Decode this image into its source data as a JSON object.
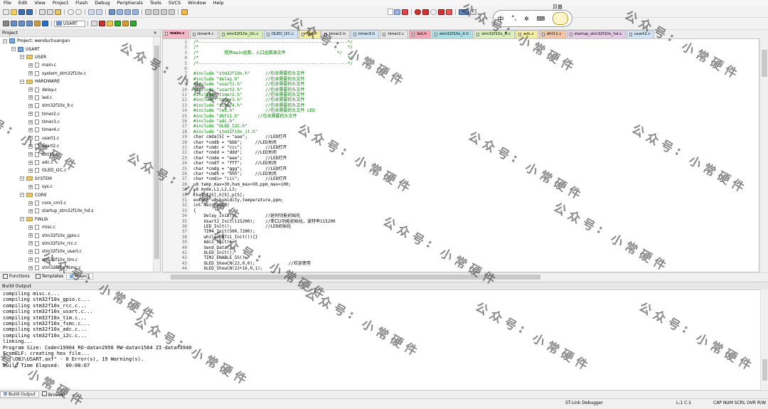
{
  "menu": [
    "File",
    "Edit",
    "View",
    "Project",
    "Flash",
    "Debug",
    "Peripherals",
    "Tools",
    "SVCS",
    "Window",
    "Help"
  ],
  "toolbar": {
    "target": "USART"
  },
  "ime": {
    "lang": "中",
    "extra": "°,",
    "user": "贝普"
  },
  "project_panel": {
    "title": "Project",
    "close": "× ",
    "tree": [
      {
        "level": 0,
        "type": "root",
        "label": "Project: wenduchuangan"
      },
      {
        "level": 1,
        "type": "target",
        "label": "USART"
      },
      {
        "level": 2,
        "type": "folder",
        "label": "USER"
      },
      {
        "level": 3,
        "type": "file",
        "label": "main.c"
      },
      {
        "level": 3,
        "type": "file",
        "label": "system_stm32f10x.c"
      },
      {
        "level": 2,
        "type": "folder",
        "label": "HARDWARE"
      },
      {
        "level": 3,
        "type": "file",
        "label": "delay.c"
      },
      {
        "level": 3,
        "type": "file",
        "label": "led.c"
      },
      {
        "level": 3,
        "type": "file",
        "label": "stm32f10x_it.c"
      },
      {
        "level": 3,
        "type": "file",
        "label": "timer2.c"
      },
      {
        "level": 3,
        "type": "file",
        "label": "timer3.c"
      },
      {
        "level": 3,
        "type": "file",
        "label": "timer4.c"
      },
      {
        "level": 3,
        "type": "file",
        "label": "usart1.c"
      },
      {
        "level": 3,
        "type": "file",
        "label": "usart2.c"
      },
      {
        "level": 3,
        "type": "file",
        "label": "dht11.c"
      },
      {
        "level": 3,
        "type": "file",
        "label": "adc.c"
      },
      {
        "level": 3,
        "type": "file",
        "label": "OLED_I2C.c"
      },
      {
        "level": 2,
        "type": "folder",
        "label": "SYSTEM"
      },
      {
        "level": 3,
        "type": "file",
        "label": "sys.c"
      },
      {
        "level": 2,
        "type": "folder",
        "label": "CORE"
      },
      {
        "level": 3,
        "type": "file",
        "label": "core_cm3.c"
      },
      {
        "level": 3,
        "type": "file",
        "label": "startup_stm32f10x_hd.s"
      },
      {
        "level": 2,
        "type": "folder",
        "label": "FWLib"
      },
      {
        "level": 3,
        "type": "file",
        "label": "misc.c"
      },
      {
        "level": 3,
        "type": "file",
        "label": "stm32f10x_gpio.c"
      },
      {
        "level": 3,
        "type": "file",
        "label": "stm32f10x_rcc.c"
      },
      {
        "level": 3,
        "type": "file",
        "label": "stm32f10x_usart.c"
      },
      {
        "level": 3,
        "type": "file",
        "label": "stm32f10x_tim.c"
      },
      {
        "level": 3,
        "type": "file",
        "label": "stm32f10x_fsmc.c"
      }
    ],
    "tabs": [
      "Functions",
      "Templates",
      "Project"
    ]
  },
  "file_tabs": [
    {
      "label": "main.c",
      "color": "#f3b7c7",
      "active": true
    },
    {
      "label": "timer4.c",
      "color": "#e6e6e6"
    },
    {
      "label": "stm32f10x_i2c.c",
      "color": "#d9f0b8"
    },
    {
      "label": "OLED_I2C.c",
      "color": "#cfe3f7"
    },
    {
      "label": "led.c",
      "color": "#f7ee9a"
    },
    {
      "label": "timer2.h",
      "color": "#e6e6e6"
    },
    {
      "label": "timer3.h",
      "color": "#cfe3f7"
    },
    {
      "label": "timer2.c",
      "color": "#e6e6e6"
    },
    {
      "label": "led.h",
      "color": "#f2a6b6"
    },
    {
      "label": "stm32f10x_it.h",
      "color": "#a8e0e8"
    },
    {
      "label": "stm32f10x_it.c",
      "color": "#d9f0b8"
    },
    {
      "label": "adc.c",
      "color": "#f7ee9a"
    },
    {
      "label": "dht11.c",
      "color": "#f3c4a6"
    },
    {
      "label": "startup_stm32f10x_hd.s",
      "color": "#e5cbe8"
    },
    {
      "label": "usart2.c",
      "color": "#cfe3f7"
    }
  ],
  "code": [
    {
      "n": "1",
      "t": "/*----------------------------------------------------------*/",
      "c": "#008000"
    },
    {
      "n": "2",
      "t": "/*                                                          */",
      "c": "#008000"
    },
    {
      "n": "3",
      "t": "/*          程序main函数，入口函数源文件                    */",
      "c": "#008000"
    },
    {
      "n": "4",
      "t": "/*                                                          */",
      "c": "#008000"
    },
    {
      "n": "5",
      "t": "/*----------------------------------------------------------*/",
      "c": "#008000"
    },
    {
      "n": "6",
      "t": "",
      "c": "#000"
    },
    {
      "n": "7",
      "t": "#include \"stm32f10x.h\"      //包含需要的头文件",
      "c": "#008000"
    },
    {
      "n": "8",
      "t": "#include \"delay.h\"          //包含需要的头文件",
      "c": "#008000"
    },
    {
      "n": "9",
      "t": "#include \"usart1.h\"         //包含需要的头文件",
      "c": "#008000"
    },
    {
      "n": "10",
      "t": "#include \"usart2.h\"         //包含需要的头文件",
      "c": "#008000"
    },
    {
      "n": "11",
      "t": "#include \"timer2.h\"         //包含需要的头文件",
      "c": "#008000"
    },
    {
      "n": "12",
      "t": "#include \"timer3.h\"         //包含需要的头文件",
      "c": "#008000"
    },
    {
      "n": "13",
      "t": "#include \"timer4.h\"         //包含需要的头文件",
      "c": "#008000"
    },
    {
      "n": "14",
      "t": "#include \"led.h\"            //包含需要的头文件 LED",
      "c": "#008000"
    },
    {
      "n": "15",
      "t": "#include \"dht11.h\"       //包含需要的头文件",
      "c": "#008000"
    },
    {
      "n": "16",
      "t": "#include \"adc.h\"",
      "c": "#008000"
    },
    {
      "n": "17",
      "t": "#include \"OLED_I2C.h\"",
      "c": "#008000"
    },
    {
      "n": "18",
      "t": "#include \"stm32f10x_it.h\"",
      "c": "#008000"
    },
    {
      "n": "19",
      "t": "char cmda[5] = \"aaa\";       //LED打开",
      "c": "#000"
    },
    {
      "n": "20",
      "t": "char *cmdb = \"bbb\";     //LED关闭",
      "c": "#000"
    },
    {
      "n": "21",
      "t": "char *cmdc = \"ccc\";         //LED打开",
      "c": "#000"
    },
    {
      "n": "22",
      "t": "char *cmdd = \"ddd\";     //LED关闭",
      "c": "#000"
    },
    {
      "n": "23",
      "t": "char *cmde = \"eee\";         //LED打开",
      "c": "#000"
    },
    {
      "n": "24",
      "t": "char *cmdf = \"fff\";     //LED关闭",
      "c": "#000"
    },
    {
      "n": "25",
      "t": "char *cmdg = \"ggg\";         //LED打开",
      "c": "#000"
    },
    {
      "n": "26",
      "t": "char *cmdh = \"hhh\";     //LED关闭",
      "c": "#000"
    },
    {
      "n": "27",
      "t": "char *cmdi= \"iii\";          //LED打开",
      "c": "#000"
    },
    {
      "n": "28",
      "t": "u8 temp_max=30,hum_max=50,ppm_max=100;",
      "c": "#000"
    },
    {
      "n": "29",
      "t": "u8 mode,L1,L2,L3;",
      "c": "#000"
    },
    {
      "n": "30",
      "t": "char t[5],h[5],p[5];",
      "c": "#000"
    },
    {
      "n": "31",
      "t": "extern u8 humidity,temperature,ppm;",
      "c": "#000"
    },
    {
      "n": "32",
      "t": "int main(void)",
      "c": "#000"
    },
    {
      "n": "33",
      "t": "{",
      "c": "#000"
    },
    {
      "n": "34",
      "t": "    Delay_Init();           //延时功能初始化",
      "c": "#000"
    },
    {
      "n": "35",
      "t": "    Usart2_Init(115200);    //串口2功能初始化，波特率115200",
      "c": "#000"
    },
    {
      "n": "36",
      "t": "    LED_Init();             //LED初始化",
      "c": "#000"
    },
    {
      "n": "37",
      "t": "    TIM4_Init(500,7200);",
      "c": "#000"
    },
    {
      "n": "38",
      "t": "    while(DHT11_Init()){}",
      "c": "#000"
    },
    {
      "n": "39",
      "t": "    Adc2_Init();",
      "c": "#000"
    },
    {
      "n": "40",
      "t": "    Send_Data();",
      "c": "#000"
    },
    {
      "n": "41",
      "t": "    OLED_Init();",
      "c": "#000"
    },
    {
      "n": "42",
      "t": "    TIM2_ENABLE_5S();",
      "c": "#000"
    },
    {
      "n": "43",
      "t": "    OLED_ShowCN(22,0,0);             //欢迎使用",
      "c": "#000"
    },
    {
      "n": "44",
      "t": "    OLED_ShowCN(22+16,0,1);",
      "c": "#000"
    }
  ],
  "build_output": {
    "title": "Build Output",
    "lines": [
      "compiling misc.c...",
      "compiling stm32f10x_gpio.c...",
      "compiling stm32f10x_rcc.c...",
      "compiling stm32f10x_usart.c...",
      "compiling stm32f10x_tim.c...",
      "compiling stm32f10x_fsmc.c...",
      "compiling stm32f10x_adc.c...",
      "compiling stm32f10x_i2c.c...",
      "linking...",
      "Program Size: Code=19904 RO-data=2956 RW-data=1564 ZI-data=3940",
      "FromELF: creating hex file...",
      "\"..\\OBJ\\USART.axf\" - 0 Error(s), 19 Warning(s).",
      "Build Time Elapsed:  00:00:07"
    ],
    "tabs": [
      "Build Output",
      "Browser"
    ]
  },
  "status": {
    "debugger": "ST-Link Debugger",
    "pos": "L:1 C:1",
    "flags": "CAP NUM SCRL OVR R/W"
  },
  "watermark": [
    "公",
    "众",
    "号",
    ":",
    "小",
    "常",
    "硬",
    "件"
  ]
}
